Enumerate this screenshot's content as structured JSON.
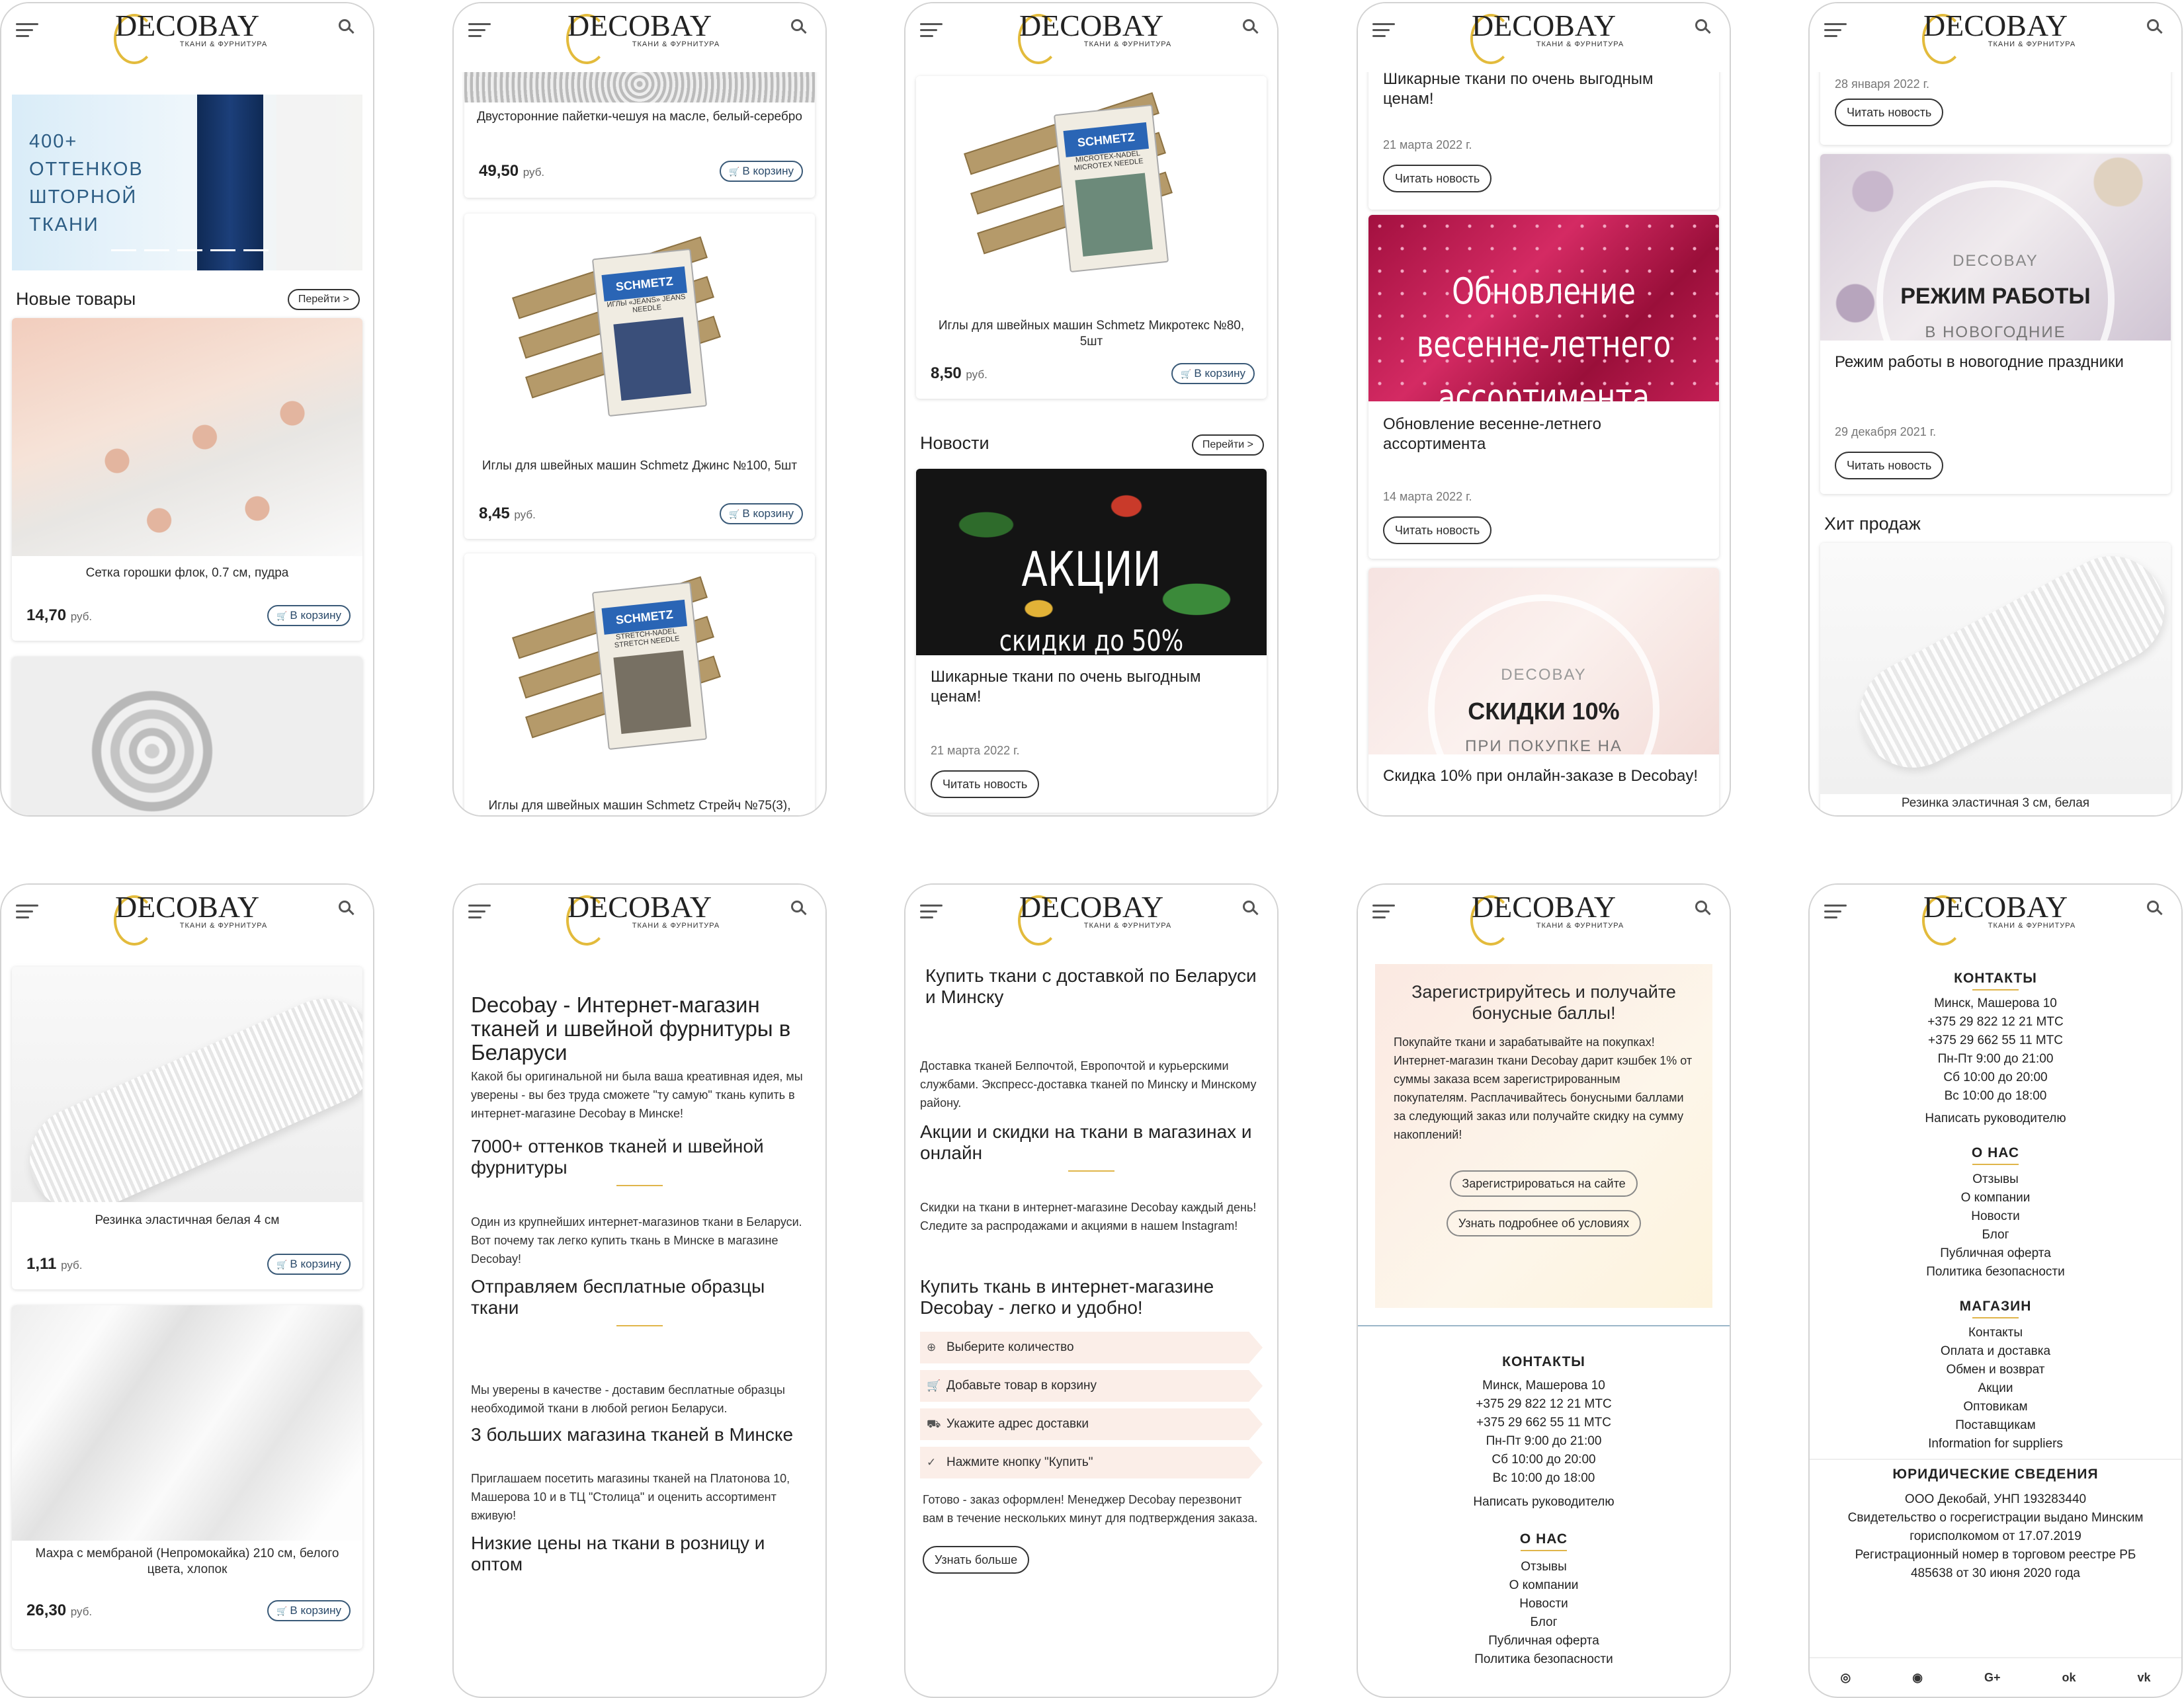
{
  "brand": {
    "name": "DECOBAY",
    "sub": "ТКАНИ & ФУРНИТУРА"
  },
  "p1": {
    "banner": {
      "l1": "400+",
      "l2": "ОТТЕНКОВ",
      "l3": "ШТОРНОЙ",
      "l4": "ТКАНИ"
    },
    "section": "Новые товары",
    "go": "Перейти >",
    "product": {
      "name": "Сетка горошки флок, 0.7 см, пудра",
      "price": "14,70",
      "cur": "руб.",
      "cart": "В корзину"
    }
  },
  "p2": {
    "top": {
      "name": "Двусторонние пайетки-чешуя на масле, белый-серебро",
      "price": "49,50",
      "cur": "руб.",
      "cart": "В корзину"
    },
    "p2": {
      "name": "Иглы для швейных машин Schmetz Джинс №100, 5шт",
      "price": "8,45",
      "cur": "руб.",
      "cart": "В корзину",
      "brand": "SCHMETZ",
      "label": "ИГЛЫ «JEANS» JEANS NEEDLE"
    },
    "p3": {
      "name": "Иглы для швейных машин Schmetz Стрейч №75(3),",
      "brand": "SCHMETZ",
      "label": "STRETCH-NADEL STRETCH NEEDLE"
    }
  },
  "p3": {
    "product": {
      "name": "Иглы для швейных машин Schmetz Микротекс №80, 5шт",
      "price": "8,50",
      "cur": "руб.",
      "cart": "В корзину",
      "brand": "SCHMETZ",
      "label": "MICROTEX-NADEL MICROTEX NEEDLE"
    },
    "section": "Новости",
    "go": "Перейти >",
    "news": {
      "img1": "АКЦИИ",
      "img2": "скидки до 50%",
      "title": "Шикарные ткани по очень выгодным ценам!",
      "date": "21 марта 2022 г.",
      "btn": "Читать новость"
    }
  },
  "p4": {
    "n1": {
      "title": "Шикарные ткани по очень выгодным ценам!",
      "date": "21 марта 2022 г.",
      "btn": "Читать новость"
    },
    "n2": {
      "img1": "Обновление",
      "img2": "весенне-летнего",
      "img3": "ассортимента",
      "title": "Обновление весенне-летнего ассортимента",
      "date": "14 марта 2022 г.",
      "btn": "Читать новость"
    },
    "n3": {
      "img1": "DECOBAY",
      "img2": "СКИДКИ 10%",
      "img3": "ПРИ ПОКУПКЕ НА",
      "title": "Скидка 10% при онлайн-заказе в Decobay!"
    }
  },
  "p5": {
    "n1": {
      "date": "28 января 2022 г.",
      "btn": "Читать новость"
    },
    "n2": {
      "img1": "DECOBAY",
      "img2": "РЕЖИМ РАБОТЫ",
      "img3": "В НОВОГОДНИЕ",
      "title": "Режим работы в новогодние праздники",
      "date": "29 декабря 2021 г.",
      "btn": "Читать новость"
    },
    "section": "Хит продаж",
    "product": {
      "name": "Резинка эластичная 3 см, белая"
    }
  },
  "p6": {
    "a": {
      "name": "Резинка эластичная белая 4 см",
      "price": "1,11",
      "cur": "руб.",
      "cart": "В корзину"
    },
    "b": {
      "name": "Махра с мембраной (Непромокайка) 210 см, белого цвета, хлопок",
      "price": "26,30",
      "cur": "руб.",
      "cart": "В корзину"
    }
  },
  "p7": {
    "h1": "Decobay - Интернет-магазин тканей и швейной фурнитуры в Беларуси",
    "t1": "Какой бы оригинальной ни была ваша креативная идея, мы уверены - вы без труда сможете \"ту самую\" ткань купить в интернет-магазине Decobay в Минске!",
    "h2": "7000+ оттенков тканей и швейной фурнитуры",
    "t2": "Один из крупнейших интернет-магазинов ткани в Беларуси. Вот почему так легко купить ткань в Минске в магазине Decobay!",
    "h3": "Отправляем бесплатные образцы ткани",
    "t3": "Мы уверены в качестве - доставим бесплатные образцы необходимой ткани в любой регион Беларуси.",
    "h4": "3 больших магазина тканей в Минске",
    "t4": "Приглашаем посетить магазины тканей на Платонова 10, Машерова 10 и в ТЦ \"Столица\" и оценить ассортимент вживую!",
    "h5": "Низкие цены на ткани в розницу и оптом"
  },
  "p8": {
    "h1": "Купить ткани с доставкой по Беларуси и Минску",
    "t1": "Доставка тканей Белпочтой, Европочтой и курьерскими службами. Экспресс-доставка тканей по Минску и Минскому району.",
    "h2": "Акции и скидки на ткани в магазинах и онлайн",
    "t2": "Скидки на ткани в интернет-магазине Decobay каждый день! Следите за распродажами и акциями в нашем Instagram!",
    "h3": "Купить ткань в интернет-магазине Decobay - легко и удобно!",
    "steps": [
      "Выберите количество",
      "Добавьте товар в корзину",
      "Укажите адрес доставки",
      "Нажмите кнопку \"Купить\""
    ],
    "t3": "Готово - заказ оформлен! Менеджер Decobay перезвонит вам в течение нескольких минут для подтверждения заказа.",
    "btn": "Узнать больше"
  },
  "p9": {
    "h": "Зарегистрируйтесь и получайте бонусные баллы!",
    "t": "Покупайте ткани и зарабатывайте на покупках! Интернет-магазин ткани Decobay дарит кэшбек 1% от суммы заказа всем зарегистрированным покупателям. Расплачивайтесь бонусными баллами за следующий заказ или получайте скидку на сумму накоплений!",
    "b1": "Зарегистрироваться на сайте",
    "b2": "Узнать подробнее об условиях",
    "contacts_h": "КОНТАКТЫ",
    "contacts": [
      "Минск, Машерова 10",
      "+375 29 822 12 21 МТС",
      "+375 29 662 55 11 МТС",
      "Пн-Пт 9:00 до 21:00",
      "Сб 10:00 до 20:00",
      "Вс 10:00 до 18:00"
    ],
    "write": "Написать руководителю",
    "about_h": "О НАС",
    "about": [
      "Отзывы",
      "О компании",
      "Новости",
      "Блог",
      "Публичная оферта",
      "Политика безопасности"
    ]
  },
  "p10": {
    "contacts_h": "КОНТАКТЫ",
    "contacts": [
      "Минск, Машерова 10",
      "+375 29 822 12 21 МТС",
      "+375 29 662 55 11 МТС",
      "Пн-Пт 9:00 до 21:00",
      "Сб 10:00 до 20:00",
      "Вс 10:00 до 18:00"
    ],
    "write": "Написать руководителю",
    "about_h": "О НАС",
    "about": [
      "Отзывы",
      "О компании",
      "Новости",
      "Блог",
      "Публичная оферта",
      "Политика безопасности"
    ],
    "shop_h": "МАГАЗИН",
    "shop": [
      "Контакты",
      "Оплата и доставка",
      "Обмен и возврат",
      "Акции",
      "Оптовикам",
      "Поставщикам",
      "Information for suppliers"
    ],
    "legal_h": "ЮРИДИЧЕСКИЕ СВЕДЕНИЯ",
    "legal": [
      "ООО Декобай, УНП 193283440",
      "Свидетельство о госрегистрации выдано Минским",
      "горисполкомом от 17.07.2019",
      "Регистрационный номер в торговом реестре РБ",
      "485638 от 30 июня 2020 года"
    ],
    "social": [
      "◎",
      "◉",
      "G+",
      "ok",
      "vk"
    ]
  }
}
